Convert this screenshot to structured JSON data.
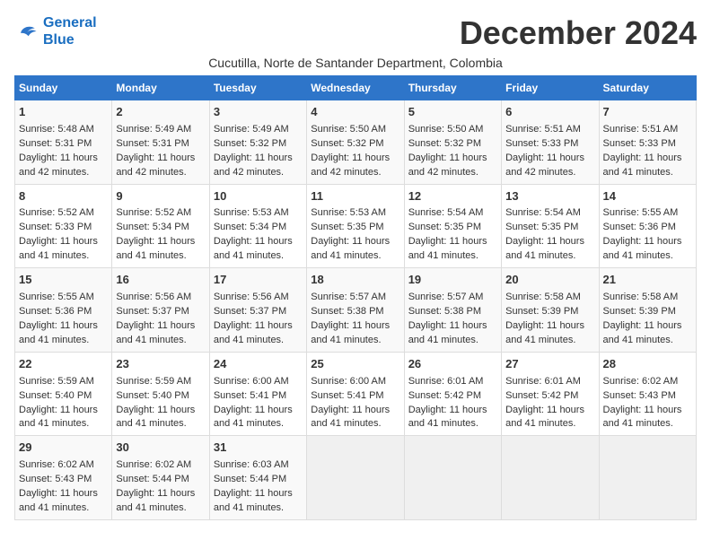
{
  "header": {
    "logo_line1": "General",
    "logo_line2": "Blue",
    "month_title": "December 2024",
    "location": "Cucutilla, Norte de Santander Department, Colombia"
  },
  "weekdays": [
    "Sunday",
    "Monday",
    "Tuesday",
    "Wednesday",
    "Thursday",
    "Friday",
    "Saturday"
  ],
  "weeks": [
    [
      {
        "day": "1",
        "sunrise": "Sunrise: 5:48 AM",
        "sunset": "Sunset: 5:31 PM",
        "daylight": "Daylight: 11 hours and 42 minutes."
      },
      {
        "day": "2",
        "sunrise": "Sunrise: 5:49 AM",
        "sunset": "Sunset: 5:31 PM",
        "daylight": "Daylight: 11 hours and 42 minutes."
      },
      {
        "day": "3",
        "sunrise": "Sunrise: 5:49 AM",
        "sunset": "Sunset: 5:32 PM",
        "daylight": "Daylight: 11 hours and 42 minutes."
      },
      {
        "day": "4",
        "sunrise": "Sunrise: 5:50 AM",
        "sunset": "Sunset: 5:32 PM",
        "daylight": "Daylight: 11 hours and 42 minutes."
      },
      {
        "day": "5",
        "sunrise": "Sunrise: 5:50 AM",
        "sunset": "Sunset: 5:32 PM",
        "daylight": "Daylight: 11 hours and 42 minutes."
      },
      {
        "day": "6",
        "sunrise": "Sunrise: 5:51 AM",
        "sunset": "Sunset: 5:33 PM",
        "daylight": "Daylight: 11 hours and 42 minutes."
      },
      {
        "day": "7",
        "sunrise": "Sunrise: 5:51 AM",
        "sunset": "Sunset: 5:33 PM",
        "daylight": "Daylight: 11 hours and 41 minutes."
      }
    ],
    [
      {
        "day": "8",
        "sunrise": "Sunrise: 5:52 AM",
        "sunset": "Sunset: 5:33 PM",
        "daylight": "Daylight: 11 hours and 41 minutes."
      },
      {
        "day": "9",
        "sunrise": "Sunrise: 5:52 AM",
        "sunset": "Sunset: 5:34 PM",
        "daylight": "Daylight: 11 hours and 41 minutes."
      },
      {
        "day": "10",
        "sunrise": "Sunrise: 5:53 AM",
        "sunset": "Sunset: 5:34 PM",
        "daylight": "Daylight: 11 hours and 41 minutes."
      },
      {
        "day": "11",
        "sunrise": "Sunrise: 5:53 AM",
        "sunset": "Sunset: 5:35 PM",
        "daylight": "Daylight: 11 hours and 41 minutes."
      },
      {
        "day": "12",
        "sunrise": "Sunrise: 5:54 AM",
        "sunset": "Sunset: 5:35 PM",
        "daylight": "Daylight: 11 hours and 41 minutes."
      },
      {
        "day": "13",
        "sunrise": "Sunrise: 5:54 AM",
        "sunset": "Sunset: 5:35 PM",
        "daylight": "Daylight: 11 hours and 41 minutes."
      },
      {
        "day": "14",
        "sunrise": "Sunrise: 5:55 AM",
        "sunset": "Sunset: 5:36 PM",
        "daylight": "Daylight: 11 hours and 41 minutes."
      }
    ],
    [
      {
        "day": "15",
        "sunrise": "Sunrise: 5:55 AM",
        "sunset": "Sunset: 5:36 PM",
        "daylight": "Daylight: 11 hours and 41 minutes."
      },
      {
        "day": "16",
        "sunrise": "Sunrise: 5:56 AM",
        "sunset": "Sunset: 5:37 PM",
        "daylight": "Daylight: 11 hours and 41 minutes."
      },
      {
        "day": "17",
        "sunrise": "Sunrise: 5:56 AM",
        "sunset": "Sunset: 5:37 PM",
        "daylight": "Daylight: 11 hours and 41 minutes."
      },
      {
        "day": "18",
        "sunrise": "Sunrise: 5:57 AM",
        "sunset": "Sunset: 5:38 PM",
        "daylight": "Daylight: 11 hours and 41 minutes."
      },
      {
        "day": "19",
        "sunrise": "Sunrise: 5:57 AM",
        "sunset": "Sunset: 5:38 PM",
        "daylight": "Daylight: 11 hours and 41 minutes."
      },
      {
        "day": "20",
        "sunrise": "Sunrise: 5:58 AM",
        "sunset": "Sunset: 5:39 PM",
        "daylight": "Daylight: 11 hours and 41 minutes."
      },
      {
        "day": "21",
        "sunrise": "Sunrise: 5:58 AM",
        "sunset": "Sunset: 5:39 PM",
        "daylight": "Daylight: 11 hours and 41 minutes."
      }
    ],
    [
      {
        "day": "22",
        "sunrise": "Sunrise: 5:59 AM",
        "sunset": "Sunset: 5:40 PM",
        "daylight": "Daylight: 11 hours and 41 minutes."
      },
      {
        "day": "23",
        "sunrise": "Sunrise: 5:59 AM",
        "sunset": "Sunset: 5:40 PM",
        "daylight": "Daylight: 11 hours and 41 minutes."
      },
      {
        "day": "24",
        "sunrise": "Sunrise: 6:00 AM",
        "sunset": "Sunset: 5:41 PM",
        "daylight": "Daylight: 11 hours and 41 minutes."
      },
      {
        "day": "25",
        "sunrise": "Sunrise: 6:00 AM",
        "sunset": "Sunset: 5:41 PM",
        "daylight": "Daylight: 11 hours and 41 minutes."
      },
      {
        "day": "26",
        "sunrise": "Sunrise: 6:01 AM",
        "sunset": "Sunset: 5:42 PM",
        "daylight": "Daylight: 11 hours and 41 minutes."
      },
      {
        "day": "27",
        "sunrise": "Sunrise: 6:01 AM",
        "sunset": "Sunset: 5:42 PM",
        "daylight": "Daylight: 11 hours and 41 minutes."
      },
      {
        "day": "28",
        "sunrise": "Sunrise: 6:02 AM",
        "sunset": "Sunset: 5:43 PM",
        "daylight": "Daylight: 11 hours and 41 minutes."
      }
    ],
    [
      {
        "day": "29",
        "sunrise": "Sunrise: 6:02 AM",
        "sunset": "Sunset: 5:43 PM",
        "daylight": "Daylight: 11 hours and 41 minutes."
      },
      {
        "day": "30",
        "sunrise": "Sunrise: 6:02 AM",
        "sunset": "Sunset: 5:44 PM",
        "daylight": "Daylight: 11 hours and 41 minutes."
      },
      {
        "day": "31",
        "sunrise": "Sunrise: 6:03 AM",
        "sunset": "Sunset: 5:44 PM",
        "daylight": "Daylight: 11 hours and 41 minutes."
      },
      null,
      null,
      null,
      null
    ]
  ]
}
